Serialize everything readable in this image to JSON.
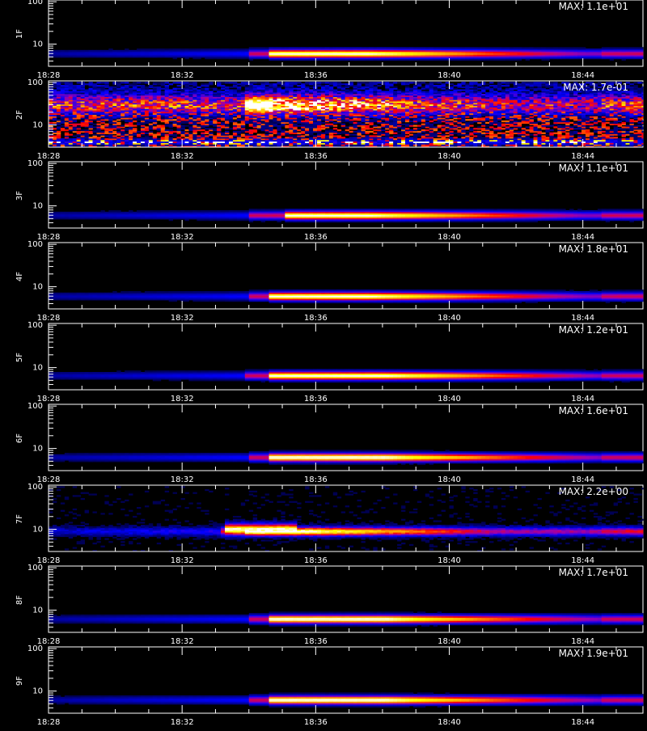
{
  "chart_data": {
    "type": "heatmap",
    "x_tick_labels": [
      "18:28",
      "18:32",
      "18:36",
      "18:40",
      "18:44"
    ],
    "x_ticks_minutes": [
      28,
      32,
      36,
      40,
      44
    ],
    "x_range_minutes": [
      28,
      45.8
    ],
    "y_scale": "log",
    "y_range": [
      3,
      110
    ],
    "y_tick_labels": [
      "10",
      "100"
    ],
    "y_tick_values": [
      10,
      100
    ],
    "panels": [
      {
        "name": "1F",
        "max_label": "MAX: 1.1e+01",
        "band_center": 6,
        "band_minutes": [
          33.9,
          45.8
        ],
        "peak_minutes": [
          34.5,
          37.5
        ],
        "noise": 0.1
      },
      {
        "name": "2F",
        "max_label": "MAX: 1.7e-01",
        "band_center": 30,
        "band_minutes": [
          28.0,
          45.8
        ],
        "peak_minutes": [
          33.8,
          34.6
        ],
        "noise": 0.9
      },
      {
        "name": "3F",
        "max_label": "MAX: 1.1e+01",
        "band_center": 6,
        "band_minutes": [
          33.9,
          45.8
        ],
        "peak_minutes": [
          35.0,
          37.5
        ],
        "noise": 0.1
      },
      {
        "name": "4F",
        "max_label": "MAX: 1.8e+01",
        "band_center": 6,
        "band_minutes": [
          33.9,
          45.8
        ],
        "peak_minutes": [
          34.5,
          37.5
        ],
        "noise": 0.1
      },
      {
        "name": "5F",
        "max_label": "MAX: 1.2e+01",
        "band_center": 6.5,
        "band_minutes": [
          33.8,
          45.8
        ],
        "peak_minutes": [
          34.5,
          38.0
        ],
        "noise": 0.1
      },
      {
        "name": "6F",
        "max_label": "MAX: 1.6e+01",
        "band_center": 6.2,
        "band_minutes": [
          33.9,
          45.8
        ],
        "peak_minutes": [
          34.5,
          38.0
        ],
        "noise": 0.1
      },
      {
        "name": "7F",
        "max_label": "MAX: 2.2e+00",
        "band_center": 9,
        "band_minutes": [
          33.1,
          45.8
        ],
        "peak_minutes": [
          33.8,
          35.2
        ],
        "noise": 0.35
      },
      {
        "name": "8F",
        "max_label": "MAX: 1.7e+01",
        "band_center": 6.2,
        "band_minutes": [
          33.9,
          45.8
        ],
        "peak_minutes": [
          34.5,
          38.0
        ],
        "noise": 0.1
      },
      {
        "name": "9F",
        "max_label": "MAX: 1.9e+01",
        "band_center": 6.2,
        "band_minutes": [
          33.9,
          45.8
        ],
        "peak_minutes": [
          34.5,
          38.0
        ],
        "noise": 0.1
      }
    ]
  }
}
